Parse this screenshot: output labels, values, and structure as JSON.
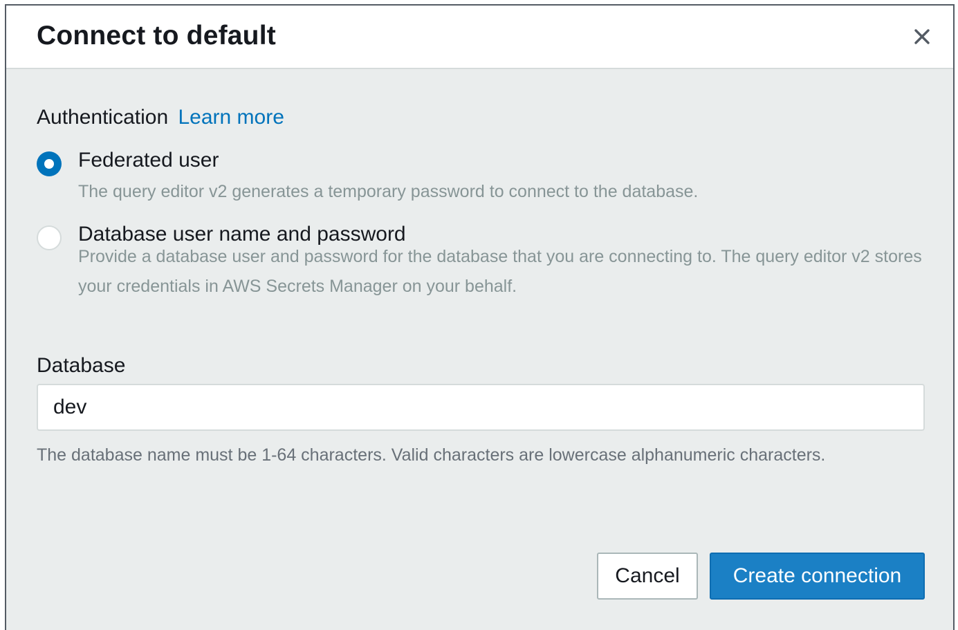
{
  "dialog": {
    "title": "Connect to default",
    "close_icon": "close-icon"
  },
  "authentication": {
    "label": "Authentication",
    "learn_more": "Learn more",
    "options": [
      {
        "label": "Federated user",
        "description": "The query editor v2 generates a temporary password to connect to the database.",
        "selected": true
      },
      {
        "label": "Database user name and password",
        "description": "Provide a database user and password for the database that you are connecting to. The query editor v2 stores your credentials in AWS Secrets Manager on your behalf.",
        "selected": false
      }
    ]
  },
  "database": {
    "label": "Database",
    "value": "dev",
    "hint": "The database name must be 1-64 characters. Valid characters are lowercase alphanumeric characters."
  },
  "footer": {
    "cancel_label": "Cancel",
    "create_label": "Create connection"
  },
  "colors": {
    "accent": "#0073bb",
    "primary_button": "#1b80c5",
    "body_background": "#eaeded",
    "muted_text": "#879596"
  }
}
